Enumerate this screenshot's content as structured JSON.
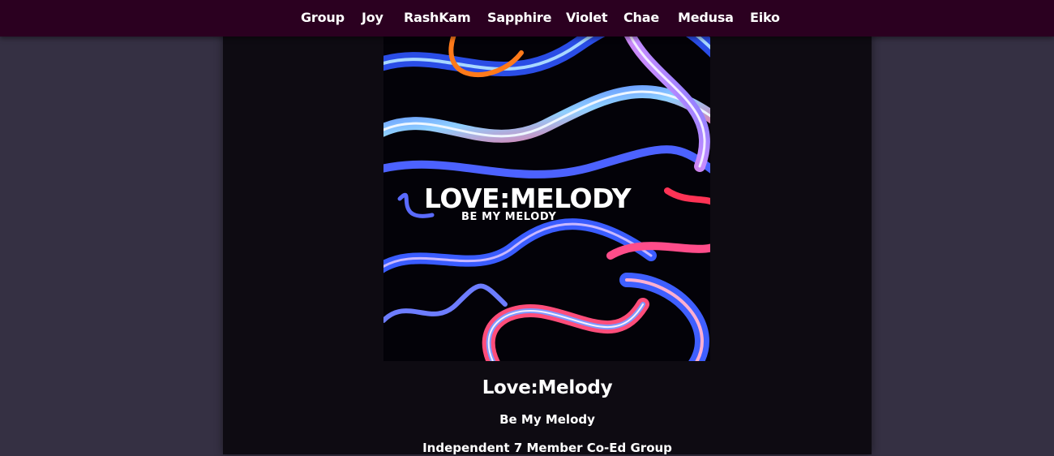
{
  "nav": {
    "items": [
      {
        "label": "Group"
      },
      {
        "label": "Joy"
      },
      {
        "label": "RashKam"
      },
      {
        "label": "Sapphire"
      },
      {
        "label": "Violet"
      },
      {
        "label": "Chae"
      },
      {
        "label": "Medusa"
      },
      {
        "label": "Eiko"
      }
    ]
  },
  "cover": {
    "logo_text": "LOVE:MELODY",
    "logo_subtext": "BE MY MELODY"
  },
  "main": {
    "title": "Love:Melody",
    "subtitle": "Be My Melody",
    "description": "Independent 7 Member Co-Ed Group"
  },
  "colors": {
    "page_background": "#353043",
    "nav_background": "#2b0020",
    "panel_background": "#0e0b12",
    "text": "#ffffff"
  }
}
